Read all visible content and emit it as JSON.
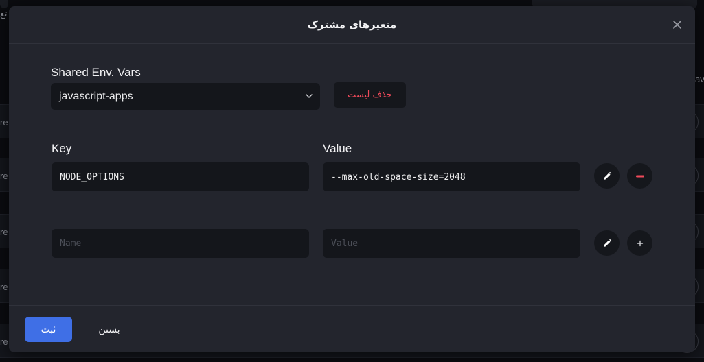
{
  "background": {
    "row_label": "re",
    "side_label": "av",
    "top_label": "تغ"
  },
  "modal": {
    "title": "متغیرهای مشترک",
    "close_icon": "close-icon"
  },
  "shared_env": {
    "label": "Shared Env. Vars",
    "selected": "javascript-apps",
    "delete_list_label": "حذف لیست"
  },
  "vars": {
    "key_header": "Key",
    "value_header": "Value",
    "rows": [
      {
        "key": "NODE_OPTIONS",
        "value": "--max-old-space-size=2048"
      }
    ],
    "new_row": {
      "name_placeholder": "Name",
      "value_placeholder": "Value"
    }
  },
  "footer": {
    "submit_label": "ثبت",
    "cancel_label": "بستن"
  },
  "colors": {
    "accent": "#3f6fe6",
    "danger": "#ef4a5a",
    "surface": "#23252d",
    "input_bg": "#14161b"
  }
}
